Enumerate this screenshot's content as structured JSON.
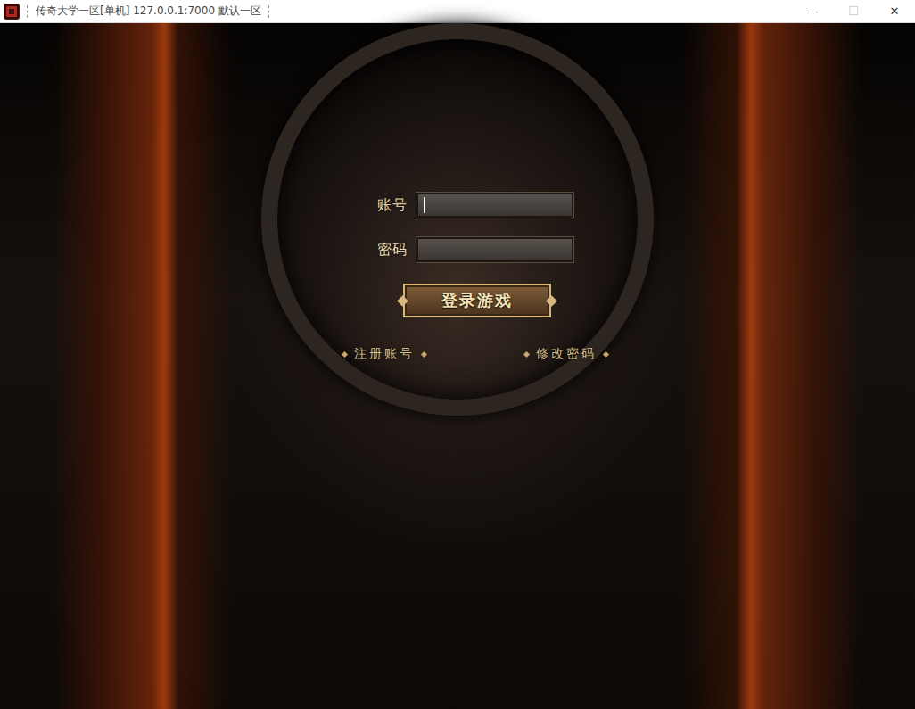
{
  "window": {
    "title": "传奇大学一区[单机] 127.0.0.1:7000  默认一区",
    "controls": [
      {
        "label": "—",
        "name": "minimize",
        "disabled": false
      },
      {
        "label": "☐",
        "name": "maximize",
        "disabled": true
      },
      {
        "label": "✕",
        "name": "close",
        "disabled": false
      }
    ]
  },
  "login": {
    "fields": [
      {
        "label": "账号",
        "value": "",
        "focused": true
      },
      {
        "label": "密码",
        "value": "",
        "focused": false
      }
    ],
    "button": "登录游戏",
    "links": [
      "注册账号",
      "修改密码"
    ]
  }
}
